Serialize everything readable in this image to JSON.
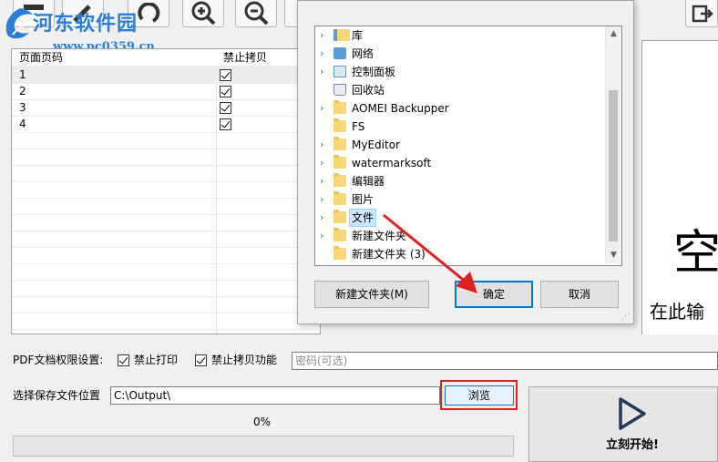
{
  "watermark": {
    "name": "河东软件园",
    "url": "www.pc0359.cn"
  },
  "grid": {
    "headers": [
      "页面页码",
      "禁止拷贝"
    ],
    "rows": [
      {
        "page": "1",
        "no_copy": true
      },
      {
        "page": "2",
        "no_copy": true
      },
      {
        "page": "3",
        "no_copy": true
      },
      {
        "page": "4",
        "no_copy": true
      }
    ]
  },
  "right_panel": {
    "big_text": "空",
    "sub_text": "在此输"
  },
  "dialog": {
    "tree_items": [
      {
        "label": "库",
        "icon": "library-icon",
        "expand": true
      },
      {
        "label": "网络",
        "icon": "network-icon",
        "expand": true
      },
      {
        "label": "控制面板",
        "icon": "control-panel-icon",
        "expand": true
      },
      {
        "label": "回收站",
        "icon": "recycle-bin-icon",
        "expand": false
      },
      {
        "label": "AOMEI Backupper",
        "icon": "folder-icon",
        "expand": true
      },
      {
        "label": "FS",
        "icon": "folder-icon",
        "expand": false
      },
      {
        "label": "MyEditor",
        "icon": "folder-icon",
        "expand": true
      },
      {
        "label": "watermarksoft",
        "icon": "folder-icon",
        "expand": true
      },
      {
        "label": "编辑器",
        "icon": "folder-icon",
        "expand": true
      },
      {
        "label": "图片",
        "icon": "folder-icon",
        "expand": true
      },
      {
        "label": "文件",
        "icon": "folder-icon",
        "expand": true,
        "selected": true
      },
      {
        "label": "新建文件夹",
        "icon": "folder-icon",
        "expand": true
      },
      {
        "label": "新建文件夹 (3)",
        "icon": "folder-icon",
        "expand": false
      }
    ],
    "new_folder_button": "新建文件夹(M)",
    "ok_button": "确定",
    "cancel_button": "取消"
  },
  "form": {
    "permission_label": "PDF文档权限设置:",
    "no_print_label": "禁止打印",
    "no_print_checked": true,
    "no_copy_label": "禁止拷贝功能",
    "no_copy_checked": true,
    "password_placeholder": "密码(可选)",
    "save_location_label": "选择保存文件位置",
    "save_path": "C:\\Output\\",
    "browse_button": "浏览",
    "progress_text": "0%",
    "progress_value": 0,
    "start_button": "立刻开始!"
  },
  "colors": {
    "accent": "#0078d7",
    "highlight": "#e02020",
    "watermark": "#2a7fd4"
  }
}
